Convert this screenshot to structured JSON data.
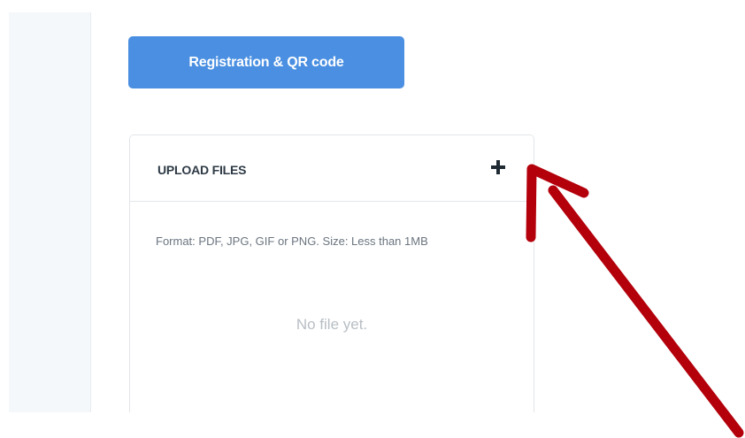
{
  "toolbar": {
    "registration_label": "Registration & QR code"
  },
  "upload": {
    "title": "UPLOAD FILES",
    "add_icon": "plus-icon",
    "hint": "Format: PDF, JPG, GIF or PNG. Size: Less than 1MB",
    "empty_text": "No file yet."
  },
  "annotation": {
    "arrow_color": "#b3000b",
    "points_to": "add-file-button"
  },
  "colors": {
    "primary": "#4a8fe1",
    "sidebar_bg": "#f4f8fb",
    "border": "#e3e6ea"
  }
}
